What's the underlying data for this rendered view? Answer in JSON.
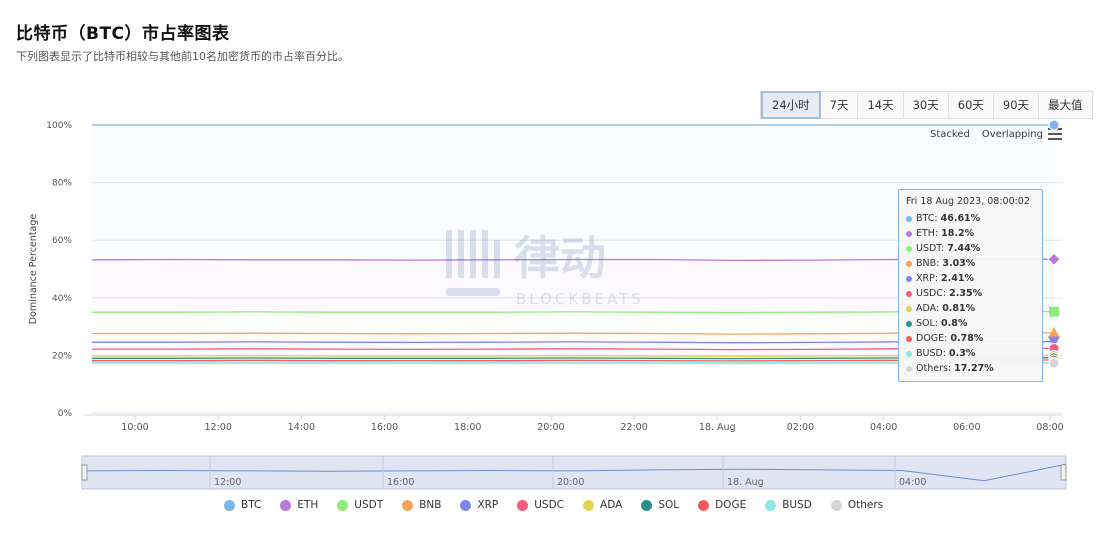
{
  "header": {
    "title": "比特币（BTC）市占率图表",
    "subtitle": "下列图表显示了比特币相较与其他前10名加密货币的市占率百分比。"
  },
  "range_selector": {
    "buttons": [
      "24小时",
      "7天",
      "14天",
      "30天",
      "60天",
      "90天",
      "最大值"
    ],
    "selected": "24小时"
  },
  "mode_switch": {
    "stacked": "Stacked",
    "overlapping": "Overlapping"
  },
  "tooltip": {
    "title": "Fri 18 Aug 2023, 08:00:02",
    "rows": [
      {
        "name": "BTC",
        "value": "46.61%"
      },
      {
        "name": "ETH",
        "value": "18.2%"
      },
      {
        "name": "USDT",
        "value": "7.44%"
      },
      {
        "name": "BNB",
        "value": "3.03%"
      },
      {
        "name": "XRP",
        "value": "2.41%"
      },
      {
        "name": "USDC",
        "value": "2.35%"
      },
      {
        "name": "ADA",
        "value": "0.81%"
      },
      {
        "name": "SOL",
        "value": "0.8%"
      },
      {
        "name": "DOGE",
        "value": "0.78%"
      },
      {
        "name": "BUSD",
        "value": "0.3%"
      },
      {
        "name": "Others",
        "value": "17.27%"
      }
    ]
  },
  "watermark": {
    "cn": "律动",
    "en": "BLOCKBEATS"
  },
  "chart_data": {
    "type": "area",
    "ylabel": "Dominance Percentage",
    "ylim": [
      0,
      100
    ],
    "y_ticks": [
      "0%",
      "20%",
      "40%",
      "60%",
      "80%",
      "100%"
    ],
    "x_ticks": [
      "10:00",
      "12:00",
      "14:00",
      "16:00",
      "18:00",
      "20:00",
      "22:00",
      "18. Aug",
      "02:00",
      "04:00",
      "06:00",
      "08:00"
    ],
    "navigator_ticks": [
      "12:00",
      "16:00",
      "20:00",
      "18. Aug",
      "04:00"
    ],
    "stacking": "stacked",
    "series": [
      {
        "name": "BTC",
        "color": "#7cb5ec",
        "top": [
          100,
          100,
          100,
          100,
          100,
          100,
          100,
          100,
          100,
          100,
          100,
          100,
          100
        ]
      },
      {
        "name": "ETH",
        "color": "#b77bdc",
        "top": [
          53.2,
          53.3,
          53.2,
          53.2,
          53.1,
          53.2,
          53.3,
          53.3,
          53.0,
          53.1,
          53.3,
          53.4,
          53.4
        ]
      },
      {
        "name": "USDT",
        "color": "#90ed7d",
        "top": [
          35.0,
          35.0,
          35.1,
          35.0,
          35.0,
          35.0,
          35.1,
          35.0,
          34.9,
          35.0,
          35.1,
          35.2,
          35.2
        ]
      },
      {
        "name": "BNB",
        "color": "#f7a35c",
        "top": [
          27.6,
          27.6,
          27.7,
          27.6,
          27.5,
          27.6,
          27.7,
          27.6,
          27.4,
          27.5,
          27.7,
          27.8,
          27.8
        ]
      },
      {
        "name": "XRP",
        "color": "#8085e9",
        "top": [
          24.6,
          24.6,
          24.7,
          24.6,
          24.5,
          24.6,
          24.7,
          24.6,
          24.4,
          24.5,
          24.7,
          24.8,
          24.8
        ]
      },
      {
        "name": "USDC",
        "color": "#f15c80",
        "top": [
          22.2,
          22.2,
          22.3,
          22.2,
          22.1,
          22.2,
          22.3,
          22.2,
          22.0,
          22.1,
          22.3,
          22.4,
          22.4
        ]
      },
      {
        "name": "ADA",
        "color": "#e4d354",
        "top": [
          19.8,
          19.8,
          19.9,
          19.8,
          19.8,
          19.8,
          19.9,
          19.8,
          19.7,
          19.8,
          19.9,
          20.0,
          20.0
        ]
      },
      {
        "name": "SOL",
        "color": "#2b908f",
        "top": [
          19.0,
          19.0,
          19.1,
          19.0,
          19.0,
          19.0,
          19.1,
          19.0,
          18.9,
          19.0,
          19.1,
          19.2,
          19.2
        ]
      },
      {
        "name": "DOGE",
        "color": "#f45b5b",
        "top": [
          18.2,
          18.2,
          18.3,
          18.2,
          18.2,
          18.2,
          18.3,
          18.2,
          18.1,
          18.2,
          18.3,
          18.4,
          18.4
        ]
      },
      {
        "name": "BUSD",
        "color": "#91e8e1",
        "top": [
          17.6,
          17.6,
          17.6,
          17.6,
          17.5,
          17.6,
          17.6,
          17.5,
          17.5,
          17.5,
          17.6,
          17.6,
          17.6
        ]
      },
      {
        "name": "Others",
        "color": "#d5d5d5",
        "top": [
          17.2,
          17.2,
          17.3,
          17.2,
          17.2,
          17.2,
          17.3,
          17.2,
          17.1,
          17.2,
          17.3,
          17.3,
          17.3
        ]
      }
    ],
    "navigator_line": [
      0.55,
      0.56,
      0.55,
      0.54,
      0.55,
      0.56,
      0.55,
      0.58,
      0.6,
      0.58,
      0.56,
      0.25,
      0.75
    ],
    "grid": true,
    "legend_position": "bottom"
  }
}
